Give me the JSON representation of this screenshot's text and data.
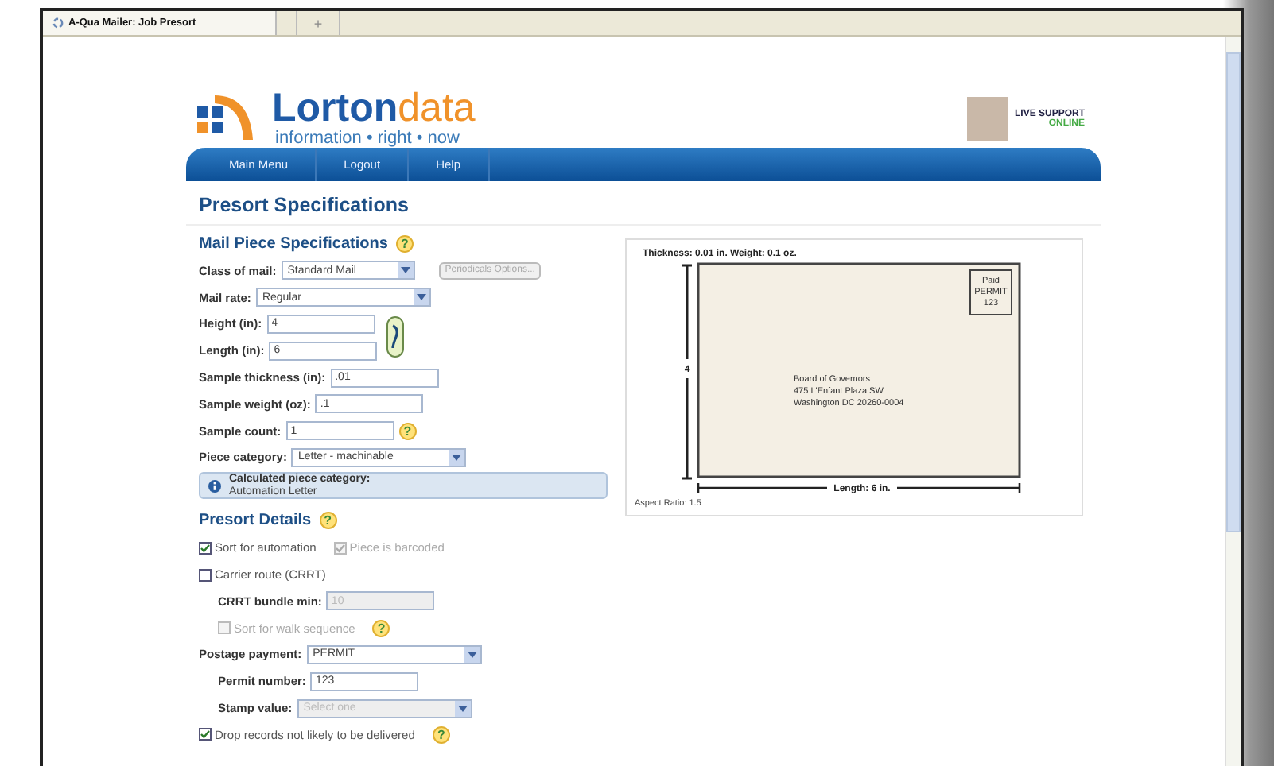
{
  "browser_tab": {
    "title": "A-Qua Mailer: Job Presort",
    "new_tab": "+"
  },
  "logo": {
    "word_main": "Lorton",
    "word_accent": "data",
    "tagline": "information • right • now"
  },
  "live_support": {
    "title": "LIVE SUPPORT",
    "status": "ONLINE"
  },
  "nav": [
    "Main Menu",
    "Logout",
    "Help"
  ],
  "page_title": "Presort Specifications",
  "mail_piece": {
    "title": "Mail Piece Specifications",
    "help": "?",
    "rows": [
      {
        "kind": "select",
        "label": "Class of mail:",
        "value": "Standard Mail",
        "button": {
          "label": "Periodicals Options...",
          "disabled": true
        }
      },
      {
        "kind": "select",
        "label": "Mail rate:",
        "value": "Regular"
      },
      {
        "kind": "input",
        "label": "Height (in):",
        "value": "4",
        "linked": true
      },
      {
        "kind": "input",
        "label": "Length (in):",
        "value": "6",
        "linked": true
      },
      {
        "kind": "input",
        "label": "Sample thickness (in):",
        "value": ".01"
      },
      {
        "kind": "input",
        "label": "Sample weight (oz):",
        "value": ".1"
      },
      {
        "kind": "input",
        "label": "Sample count:",
        "value": "1",
        "help": "?"
      },
      {
        "kind": "select",
        "label": "Piece category:",
        "value": "Letter - machinable"
      },
      {
        "kind": "info",
        "label": "Calculated piece category:",
        "value": "Automation Letter"
      }
    ]
  },
  "presort": {
    "title": "Presort Details",
    "help": "?",
    "rows": [
      {
        "kind": "checks",
        "items": [
          {
            "label": "Sort for automation",
            "checked": true,
            "disabled": false
          },
          {
            "label": "Piece is barcoded",
            "checked": true,
            "disabled": true
          }
        ]
      },
      {
        "kind": "checks",
        "items": [
          {
            "label": "Carrier route (CRRT)",
            "checked": false,
            "disabled": false
          }
        ]
      },
      {
        "kind": "input",
        "label": "CRRT bundle min:",
        "value": "10",
        "indent": true,
        "disabled": true
      },
      {
        "kind": "checks",
        "indent": true,
        "help": "?",
        "items": [
          {
            "label": "Sort for walk sequence",
            "checked": false,
            "disabled": true
          }
        ]
      },
      {
        "kind": "select",
        "label": "Postage payment:",
        "value": "PERMIT"
      },
      {
        "kind": "input",
        "label": "Permit number:",
        "value": "123",
        "indent": true
      },
      {
        "kind": "select",
        "label": "Stamp value:",
        "placeholder": "Select one",
        "indent": true,
        "disabled": true
      },
      {
        "kind": "checks",
        "help": "?",
        "items": [
          {
            "label": "Drop records not likely to be delivered",
            "checked": true,
            "disabled": false
          }
        ]
      }
    ]
  },
  "preview": {
    "thickness": "Thickness: 0.01 in.",
    "weight": "Weight: 0.1 oz.",
    "height_label": "4",
    "length_label": "Length: 6 in.",
    "stamp": [
      "Paid",
      "PERMIT",
      "123"
    ],
    "address": [
      "Board of Governors",
      "475 L'Enfant Plaza SW",
      "Washington DC  20260-0004"
    ],
    "aspect": "Aspect Ratio: 1.5"
  }
}
